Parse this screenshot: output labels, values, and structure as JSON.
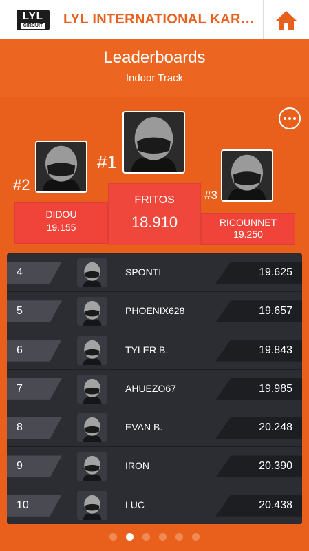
{
  "app": {
    "logo_top": "LYL",
    "logo_bottom": "CIRCUIT",
    "title": "LYL INTERNATIONAL KARTIN..."
  },
  "header": {
    "title": "Leaderboards",
    "subtitle": "Indoor Track"
  },
  "podium": {
    "first": {
      "rank": "#1",
      "name": "FRITOS",
      "time": "18.910"
    },
    "second": {
      "rank": "#2",
      "name": "DIDOU",
      "time": "19.155"
    },
    "third": {
      "rank": "#3",
      "name": "RICOUNNET",
      "time": "19.250"
    }
  },
  "leaderboard": [
    {
      "rank": "4",
      "name": "SPONTI",
      "time": "19.625"
    },
    {
      "rank": "5",
      "name": "PHOENIX628",
      "time": "19.657"
    },
    {
      "rank": "6",
      "name": "TYLER B.",
      "time": "19.843"
    },
    {
      "rank": "7",
      "name": "AHUEZO67",
      "time": "19.985"
    },
    {
      "rank": "8",
      "name": "EVAN B.",
      "time": "20.248"
    },
    {
      "rank": "9",
      "name": "IRON",
      "time": "20.390"
    },
    {
      "rank": "10",
      "name": "LUC",
      "time": "20.438"
    }
  ],
  "pagination": {
    "pages": 6,
    "active_index": 1
  },
  "colors": {
    "brand_orange": "#e8601c",
    "podium_red": "#f0433a",
    "list_bg": "#2c2d33"
  },
  "icons": {
    "home": "home-icon",
    "more": "more-options-icon",
    "avatar": "helmet-avatar-icon"
  }
}
